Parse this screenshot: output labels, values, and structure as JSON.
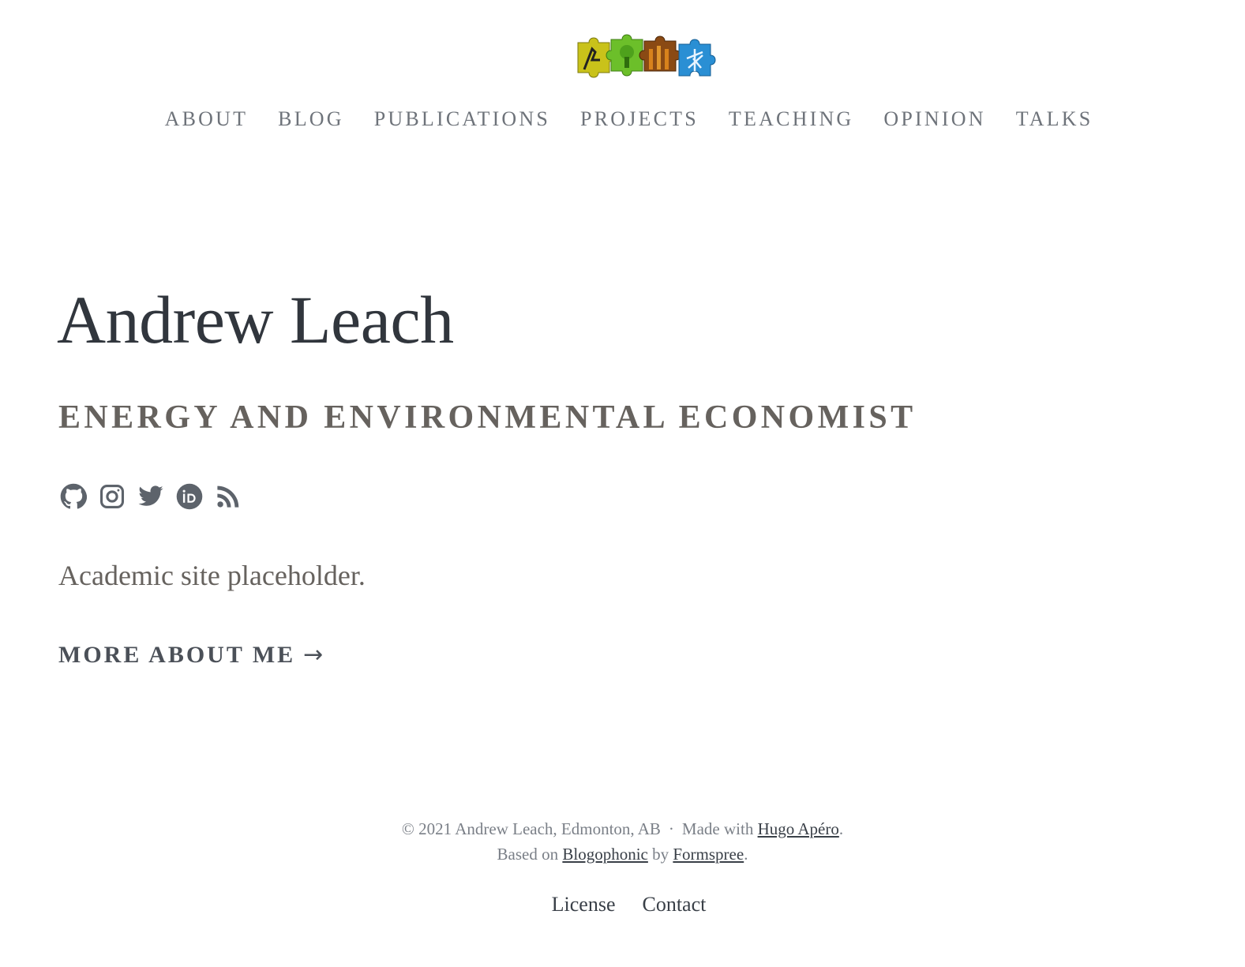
{
  "site": {
    "logo_icon": "puzzle-pieces-logo-icon"
  },
  "nav": {
    "items": [
      {
        "label": "ABOUT"
      },
      {
        "label": "BLOG"
      },
      {
        "label": "PUBLICATIONS"
      },
      {
        "label": "PROJECTS"
      },
      {
        "label": "TEACHING"
      },
      {
        "label": "OPINION"
      },
      {
        "label": "TALKS"
      }
    ]
  },
  "hero": {
    "name": "Andrew Leach",
    "subtitle": "ENERGY AND ENVIRONMENTAL ECONOMIST",
    "social_icons": [
      "github-icon",
      "instagram-icon",
      "twitter-icon",
      "orcid-icon",
      "rss-icon"
    ],
    "description": "Academic site placeholder.",
    "more_label": "MORE ABOUT ME",
    "more_arrow": "→"
  },
  "footer": {
    "copyright": "© 2021 Andrew Leach, Edmonton, AB",
    "separator": "·",
    "made_with": "Made with",
    "hugo_link": "Hugo Apéro",
    "period": ".",
    "based_on": "Based on",
    "blogophonic_link": "Blogophonic",
    "by": "by",
    "formspree_link": "Formspree",
    "links": [
      {
        "label": "License"
      },
      {
        "label": "Contact"
      }
    ]
  },
  "colors": {
    "text_dark": "#31363d",
    "text_muted": "#66625e",
    "nav": "#6e737a",
    "icon": "#5d636b",
    "logo_yellow": "#c9c21a",
    "logo_green": "#6cbf2a",
    "logo_brown": "#8a4a14",
    "logo_blue": "#2a8fd4"
  }
}
